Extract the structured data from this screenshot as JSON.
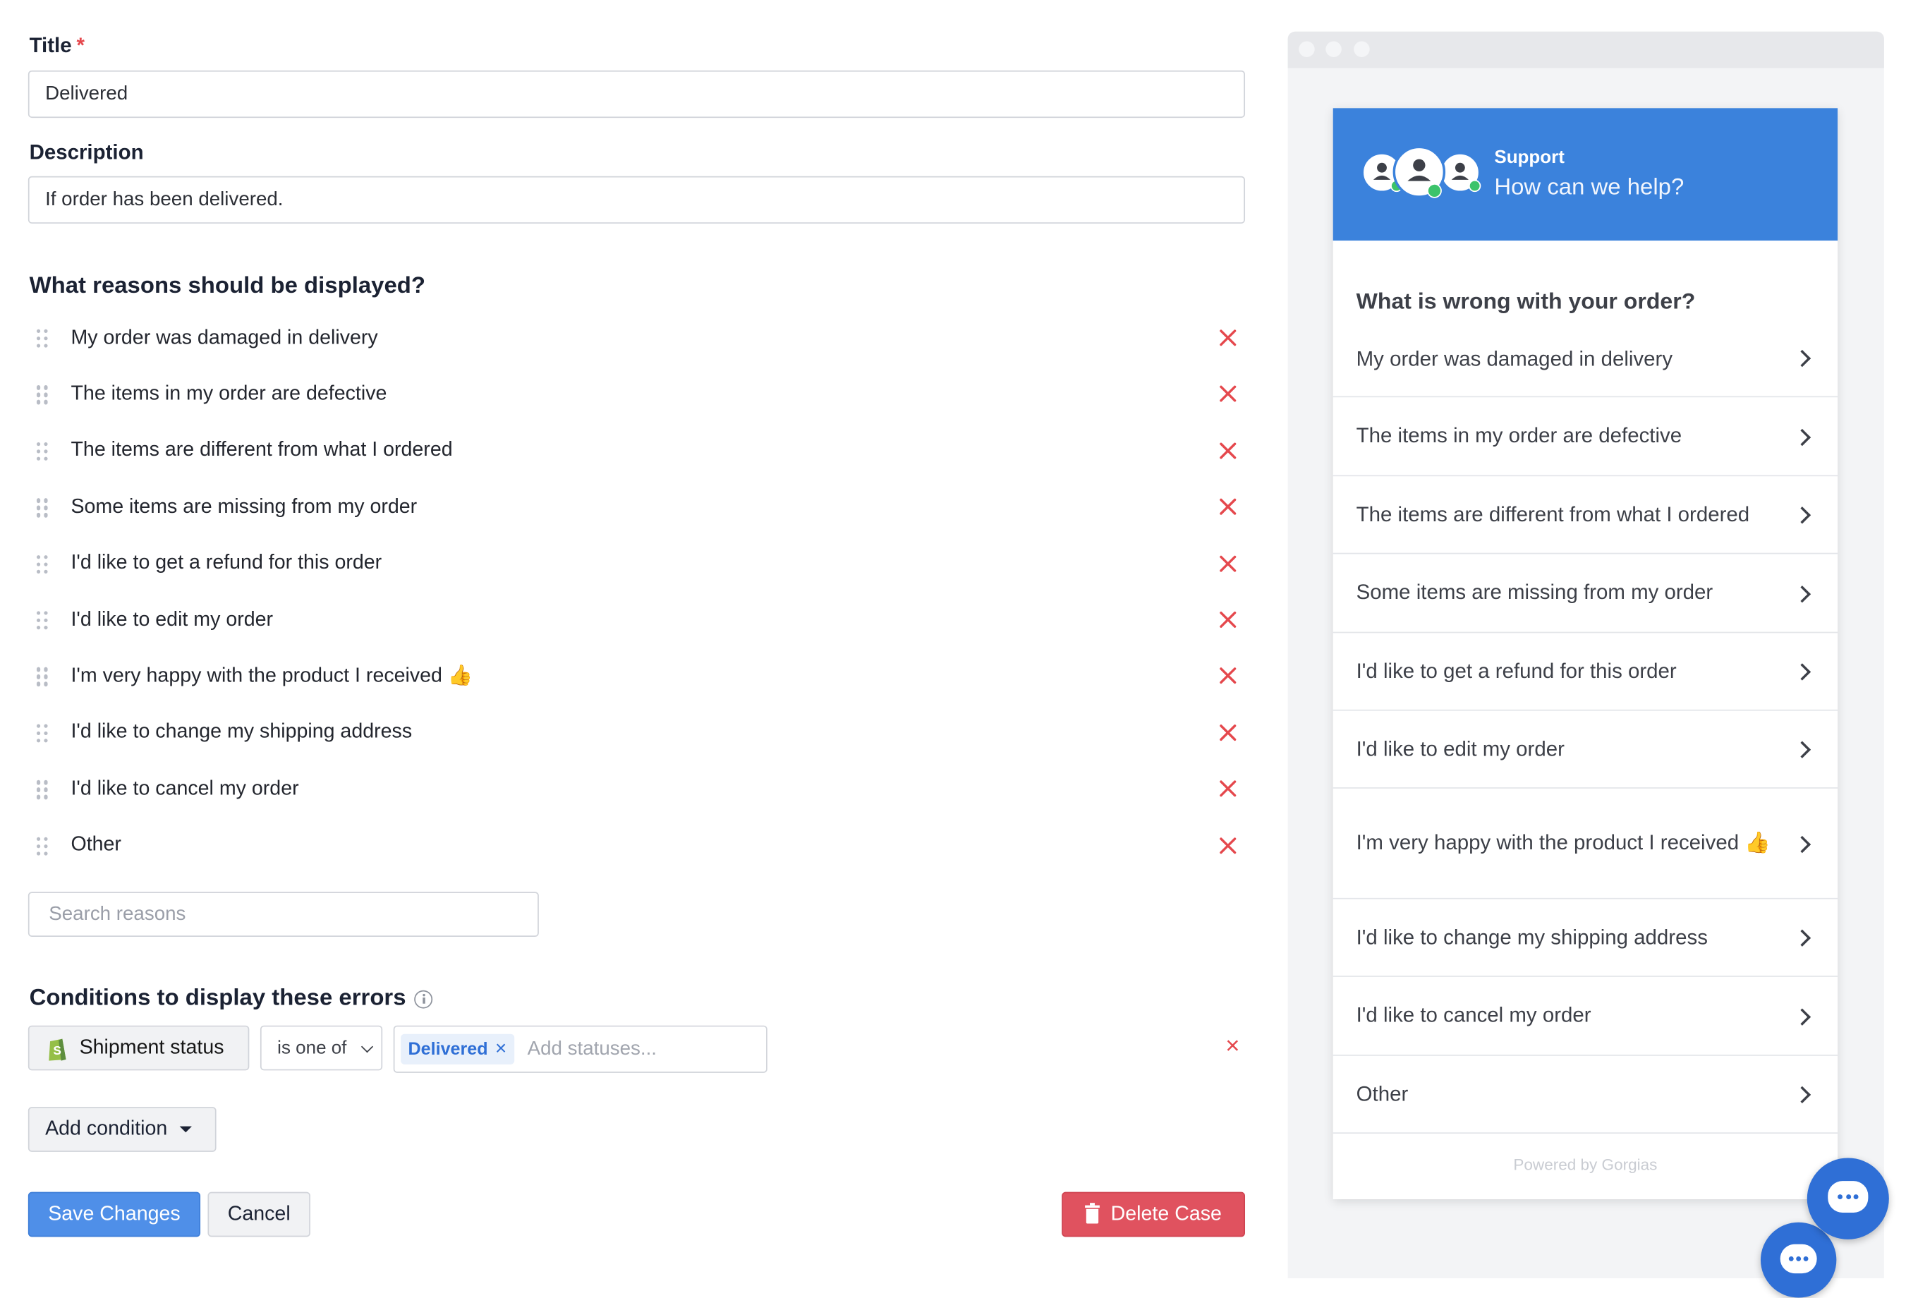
{
  "form": {
    "title_label": "Title",
    "required_mark": "*",
    "title_value": "Delivered",
    "description_label": "Description",
    "description_value": "If order has been delivered.",
    "reasons_heading": "What reasons should be displayed?",
    "reasons": [
      "My order was damaged in delivery",
      "The items in my order are defective",
      "The items are different from what I ordered",
      "Some items are missing from my order",
      "I'd like to get a refund for this order",
      "I'd like to edit my order",
      "I'm very happy with the product I received 👍",
      "I'd like to change my shipping address",
      "I'd like to cancel my order",
      "Other"
    ],
    "search_placeholder": "Search reasons",
    "conditions_heading": "Conditions to display these errors",
    "condition": {
      "field_label": "Shipment status",
      "operator": "is one of",
      "tag": "Delivered",
      "tag_remove": "×",
      "add_placeholder": "Add statuses...",
      "remove": "×"
    },
    "add_condition_label": "Add condition",
    "save_label": "Save Changes",
    "cancel_label": "Cancel",
    "delete_label": "Delete Case"
  },
  "preview": {
    "header_title": "Support",
    "header_subtitle": "How can we help?",
    "question": "What is wrong with your order?",
    "items": [
      "My order was damaged in delivery",
      "The items in my order are defective",
      "The items are different from what I ordered",
      "Some items are missing from my order",
      "I'd like to get a refund for this order",
      "I'd like to edit my order",
      "I'm very happy with the product I received 👍",
      "I'd like to change my shipping address",
      "I'd like to cancel my order",
      "Other"
    ],
    "powered_by": "Powered by Gorgias"
  },
  "colors": {
    "primary": "#3b82dc",
    "danger": "#e5484d",
    "save_button": "#4f8fe8",
    "tag_bg": "#e8f0fb",
    "tag_text": "#2f6fd6"
  }
}
